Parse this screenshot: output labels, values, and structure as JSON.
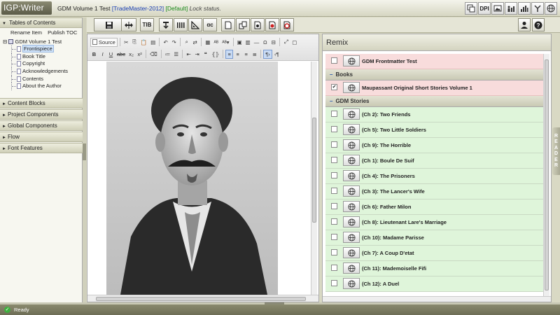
{
  "app": {
    "logo": "IGP:Writer",
    "doc_name": "GDM Volume 1 Test",
    "project_tag": "[TradeMaster-2012]",
    "view_tag": "[Default]",
    "lock_status": "Lock status."
  },
  "header_icons": [
    {
      "name": "copy-icon",
      "label": ""
    },
    {
      "name": "dpi-icon",
      "label": "DPI"
    },
    {
      "name": "image-icon",
      "label": ""
    },
    {
      "name": "people-chart-icon",
      "label": ""
    },
    {
      "name": "bar-chart-icon",
      "label": ""
    },
    {
      "name": "branch-icon",
      "label": ""
    },
    {
      "name": "globe-icon",
      "label": ""
    }
  ],
  "left": {
    "toc_header": "Tables of Contents",
    "rename_item": "Rename Item",
    "publish_toc": "Publish TOC",
    "tree_root": "GDM Volume 1 Test",
    "tree_items": [
      "Frontispiece",
      "Book Title",
      "Copyright",
      "Acknowledgements",
      "Contents",
      "About the Author"
    ],
    "sections": [
      "Content Blocks",
      "Project Components",
      "Global Components",
      "Flow",
      "Font Features"
    ]
  },
  "main_toolbar": {
    "save": "save-icon",
    "swap": "swap-icon",
    "tib": "TIB",
    "ac": "ɑс"
  },
  "editor": {
    "source_label": "Source"
  },
  "remix": {
    "title": "Remix",
    "top_item": "GDM Frontmatter Test",
    "books_header": "Books",
    "book_item": "Maupassant Original Short Stories Volume 1",
    "stories_header": "GDM Stories",
    "stories": [
      "(Ch 2): Two Friends",
      "(Ch 5): Two Little Soldiers",
      "(Ch 9): The Horrible",
      "(Ch 1): Boule De Suif",
      "(Ch 4): The Prisoners",
      "(Ch 3): The Lancer's Wife",
      "(Ch 6): Father Milon",
      "(Ch 8): Lieutenant Lare's Marriage",
      "(Ch 10): Madame Parisse",
      "(Ch 7): A Coup D'etat",
      "(Ch 11): Mademoiselle Fifi",
      "(Ch 12): A Duel"
    ]
  },
  "reader_tab": "READER",
  "status": "Ready"
}
